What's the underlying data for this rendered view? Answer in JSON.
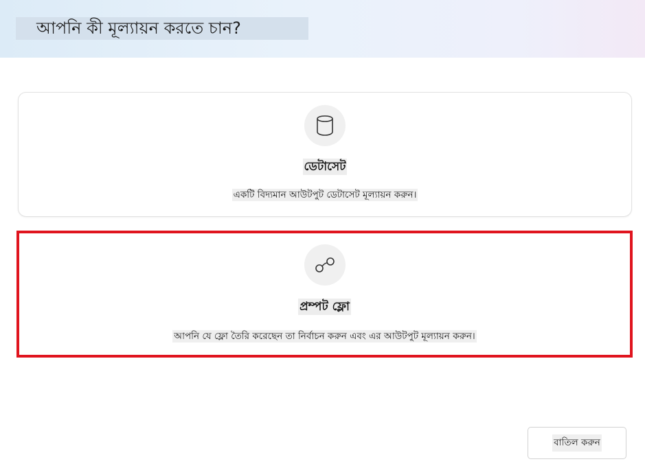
{
  "header": {
    "title": "আপনি কী মূল্যায়ন করতে চান?"
  },
  "options": [
    {
      "id": "dataset",
      "icon": "database-icon",
      "title": "ডেটাসেট",
      "description": "একটি বিদ্যমান আউটপুট ডেটাসেট মূল্যায়ন করুন।",
      "selected": false
    },
    {
      "id": "prompt-flow",
      "icon": "flow-icon",
      "title": "প্রম্পট ফ্লো",
      "description": "আপনি যে ফ্লো তৈরি করেছেন তা নির্বাচন করুন এবং এর আউটপুট মূল্যায়ন করুন।",
      "selected": true
    }
  ],
  "footer": {
    "cancel_label": "বাতিল করুন"
  },
  "colors": {
    "selection_border": "#e0141e",
    "header_gradient_start": "#dcebf7",
    "header_gradient_end": "#f3e9f6"
  }
}
